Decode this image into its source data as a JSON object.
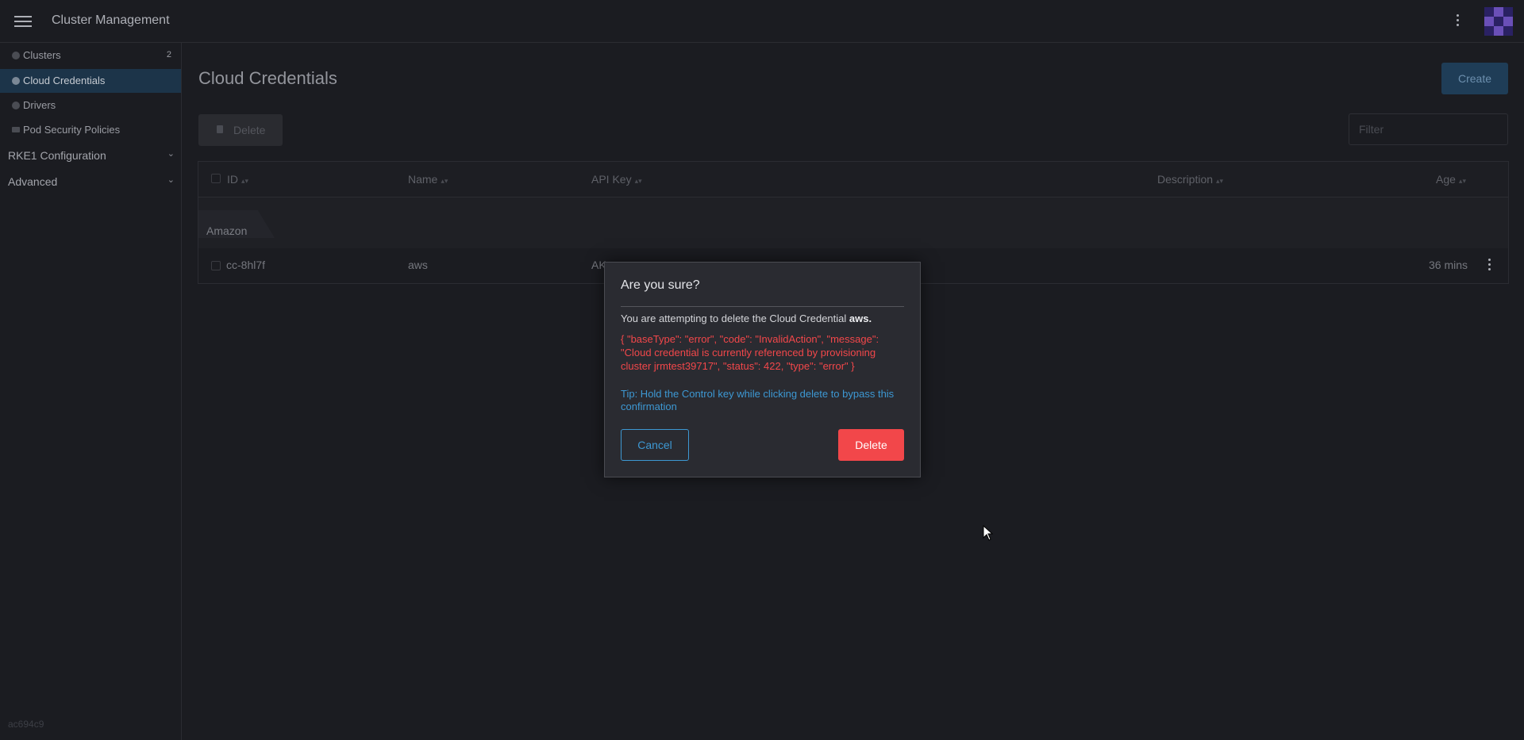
{
  "header": {
    "title": "Cluster Management",
    "menu_icon": "hamburger-icon",
    "more_icon": "kebab-vertical-icon",
    "avatar_icon": "user-avatar-icon"
  },
  "sidebar": {
    "items": [
      {
        "label": "Clusters",
        "count": "2",
        "icon": "circle-icon"
      },
      {
        "label": "Cloud Credentials",
        "count": "",
        "icon": "circle-icon",
        "active": true
      },
      {
        "label": "Drivers",
        "count": "",
        "icon": "circle-icon"
      },
      {
        "label": "Pod Security Policies",
        "count": "",
        "icon": "folder-icon"
      }
    ],
    "groups": [
      {
        "label": "RKE1 Configuration",
        "icon": "chevron-down-icon"
      },
      {
        "label": "Advanced",
        "icon": "chevron-down-icon"
      }
    ],
    "version": "ac694c9"
  },
  "main": {
    "title": "Cloud Credentials",
    "create_label": "Create",
    "bulk_delete_label": "Delete",
    "filter_placeholder": "Filter",
    "table": {
      "columns": [
        "ID",
        "Name",
        "API Key",
        "Description",
        "Age"
      ],
      "groups": [
        {
          "label": "Amazon",
          "rows": [
            {
              "id": "cc-8hl7f",
              "name": "aws",
              "api_key": "AK",
              "description": "",
              "age": "36 mins"
            }
          ]
        }
      ]
    }
  },
  "modal": {
    "title": "Are you sure?",
    "text_prefix": "You are attempting to delete the Cloud Credential",
    "target": "aws.",
    "error": "{ \"baseType\": \"error\", \"code\": \"InvalidAction\", \"message\": \"Cloud credential is currently referenced by provisioning cluster jrmtest39717\", \"status\": 422, \"type\": \"error\" }",
    "tip": "Tip: Hold the Control key while clicking delete to bypass this confirmation",
    "cancel_label": "Cancel",
    "confirm_label": "Delete"
  },
  "colors": {
    "background": "#1b1c21",
    "active_nav": "#1c3449",
    "primary": "#3d98d3",
    "danger": "#f2474a"
  }
}
